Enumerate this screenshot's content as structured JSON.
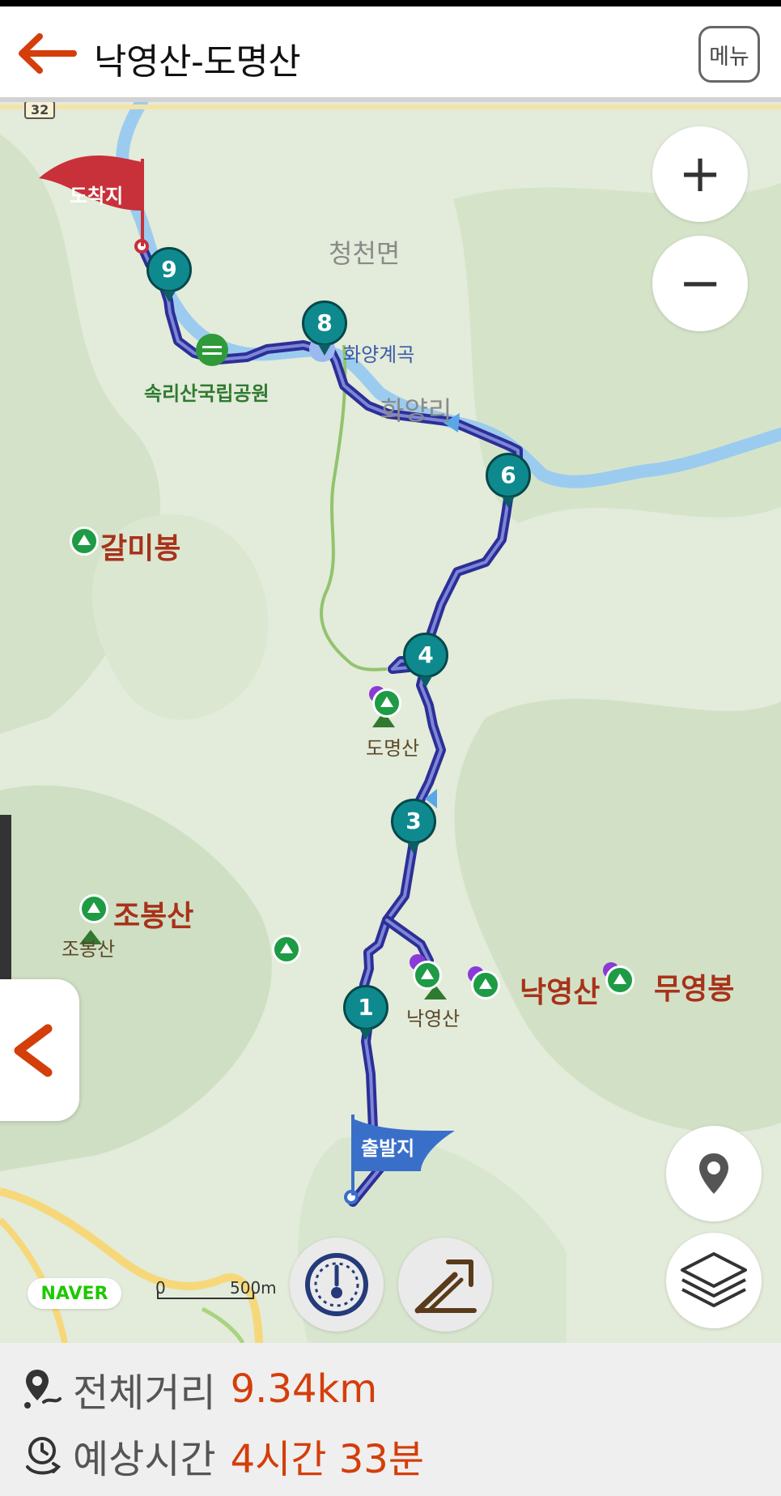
{
  "header": {
    "title": "낙영산-도명산",
    "menu_label": "메뉴"
  },
  "map": {
    "road_badge": "32",
    "region_labels": {
      "town": "청천면",
      "village": "화양리",
      "valley": "화양계곡",
      "park": "속리산국립공원"
    },
    "peaks": [
      {
        "id": "galmibong",
        "label": "갈미봉"
      },
      {
        "id": "jobongsan",
        "label": "조봉산",
        "sub_label": "조봉산"
      },
      {
        "id": "dommyeongsan",
        "label": "도명산"
      },
      {
        "id": "nakyeongsan_sm",
        "label": "낙영산"
      },
      {
        "id": "nakyeongsan",
        "label": "낙영산"
      },
      {
        "id": "muyeongbong",
        "label": "무영봉"
      }
    ],
    "start_label": "출발지",
    "end_label": "도착지",
    "waypoints": [
      "1",
      "3",
      "4",
      "6",
      "8",
      "9"
    ],
    "naver_logo": "NAVER",
    "scale": {
      "zero": "0",
      "distance": "500m"
    },
    "icons": {
      "zoom_in": "plus-icon",
      "zoom_out": "minus-icon",
      "location": "location-pin-icon",
      "layers": "layers-icon",
      "speedometer": "speedometer-icon",
      "elevation": "elevation-profile-icon",
      "collapse": "chevron-left-icon"
    },
    "colors": {
      "route": "#3a3fb5",
      "start_flag": "#3a6fc9",
      "end_flag": "#c8303a",
      "waypoint": "#0e8a8f",
      "river": "#8ec3f0"
    }
  },
  "summary": {
    "distance_label": "전체거리",
    "distance_value": "9.34km",
    "time_label": "예상시간",
    "time_value": "4시간 33분"
  }
}
